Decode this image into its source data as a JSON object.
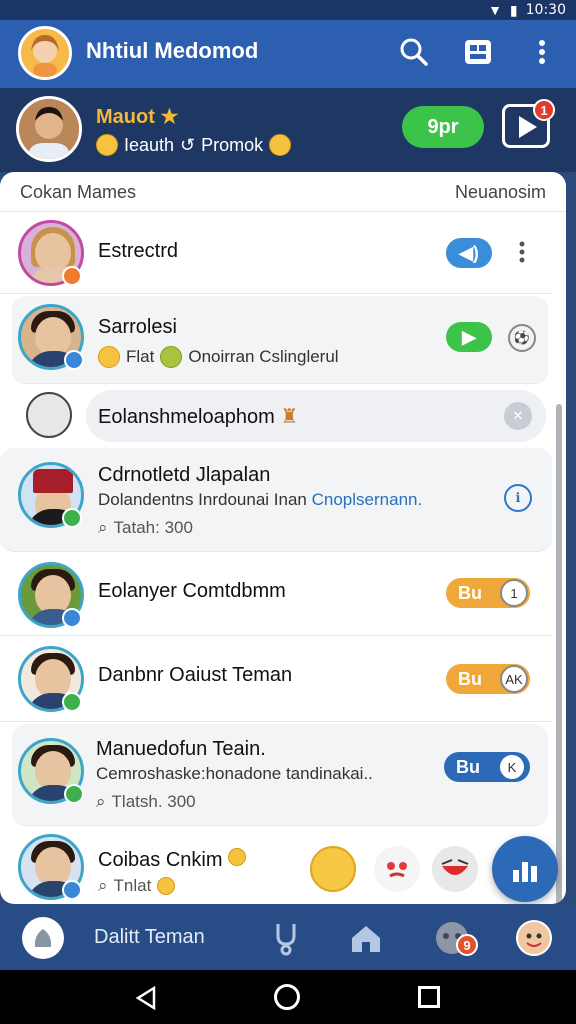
{
  "status_bar": {
    "time": "10:30"
  },
  "app_bar": {
    "title": "Nhtiul Medomod"
  },
  "profile": {
    "name": "Mauot",
    "sub_left": "Ieauth",
    "sub_right": "Promok",
    "promo_button": "9pr",
    "video_badge": "1"
  },
  "list_header": {
    "left": "Cokan Mames",
    "right": "Neuanosim"
  },
  "contacts": [
    {
      "name": "Estrectrd"
    },
    {
      "name": "Sarrolesi",
      "sub": "Flat",
      "sub2": "Onoirran Cslinglerul"
    },
    {
      "name": "Eolanshmeloaphom"
    },
    {
      "name": "Cdrnotletd Jlapalan",
      "sub": "Dolandentns Inrdounai Inan",
      "sub_link": "Cnoplsernann.",
      "meta": "Tatah: 300"
    },
    {
      "name": "Eolanyer Comtdbmm",
      "pill": "Bu",
      "circle": "1"
    },
    {
      "name": "Danbnr Oaiust Teman",
      "pill": "Bu",
      "circle": "AK"
    },
    {
      "name": "Manuedofun Teain.",
      "sub": "Cemroshaske:honadone tandinakai..",
      "meta": "Tlatsh. 300",
      "pill": "Bu",
      "circle": "K"
    },
    {
      "name": "Coibas Cnkim",
      "meta": "Tnlat"
    }
  ],
  "bottom_nav": {
    "label": "Dalitt Teman",
    "badge": "9"
  },
  "colors": {
    "accent": "#2d5fb0",
    "green": "#3cc34a",
    "orange": "#f0a83a"
  }
}
